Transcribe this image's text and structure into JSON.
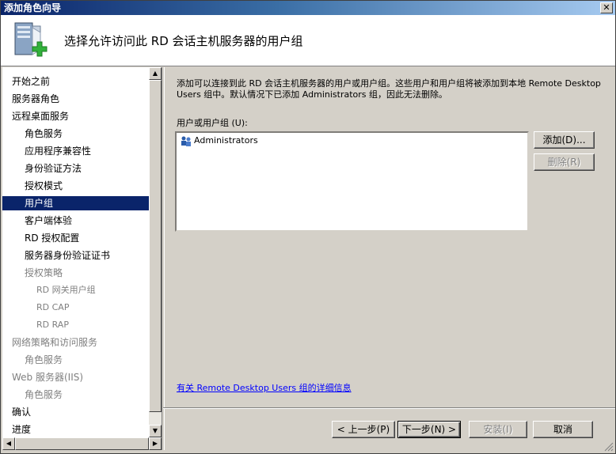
{
  "window": {
    "title": "添加角色向导",
    "close_label": "✕"
  },
  "header": {
    "heading": "选择允许访问此 RD 会话主机服务器的用户组",
    "icon": "server-add-icon"
  },
  "nav": {
    "items": [
      {
        "label": "开始之前",
        "level": 0,
        "state": "normal"
      },
      {
        "label": "服务器角色",
        "level": 0,
        "state": "normal"
      },
      {
        "label": "远程桌面服务",
        "level": 0,
        "state": "normal"
      },
      {
        "label": "角色服务",
        "level": 1,
        "state": "normal"
      },
      {
        "label": "应用程序兼容性",
        "level": 1,
        "state": "normal"
      },
      {
        "label": "身份验证方法",
        "level": 1,
        "state": "normal"
      },
      {
        "label": "授权模式",
        "level": 1,
        "state": "normal"
      },
      {
        "label": "用户组",
        "level": 1,
        "state": "selected"
      },
      {
        "label": "客户端体验",
        "level": 1,
        "state": "normal"
      },
      {
        "label": "RD 授权配置",
        "level": 1,
        "state": "normal"
      },
      {
        "label": "服务器身份验证证书",
        "level": 1,
        "state": "normal"
      },
      {
        "label": "授权策略",
        "level": 1,
        "state": "disabled"
      },
      {
        "label": "RD 网关用户组",
        "level": 2,
        "state": "disabled"
      },
      {
        "label": "RD CAP",
        "level": 2,
        "state": "disabled"
      },
      {
        "label": "RD RAP",
        "level": 2,
        "state": "disabled"
      },
      {
        "label": "网络策略和访问服务",
        "level": 0,
        "state": "disabled"
      },
      {
        "label": "角色服务",
        "level": 1,
        "state": "disabled"
      },
      {
        "label": "Web 服务器(IIS)",
        "level": 0,
        "state": "disabled"
      },
      {
        "label": "角色服务",
        "level": 1,
        "state": "disabled"
      },
      {
        "label": "确认",
        "level": 0,
        "state": "normal"
      },
      {
        "label": "进度",
        "level": 0,
        "state": "normal"
      }
    ]
  },
  "content": {
    "description": "添加可以连接到此 RD 会话主机服务器的用户或用户组。这些用户和用户组将被添加到本地 Remote Desktop Users 组中。默认情况下已添加 Administrators 组，因此无法删除。",
    "list_label": "用户或用户组 (U):",
    "list_items": [
      "Administrators"
    ],
    "add_button": "添加(D)...",
    "remove_button": "删除(R)",
    "help_link": "有关 Remote Desktop Users 组的详细信息"
  },
  "footer": {
    "prev_button": "< 上一步(P)",
    "next_button": "下一步(N) >",
    "install_button": "安装(I)",
    "cancel_button": "取消"
  }
}
